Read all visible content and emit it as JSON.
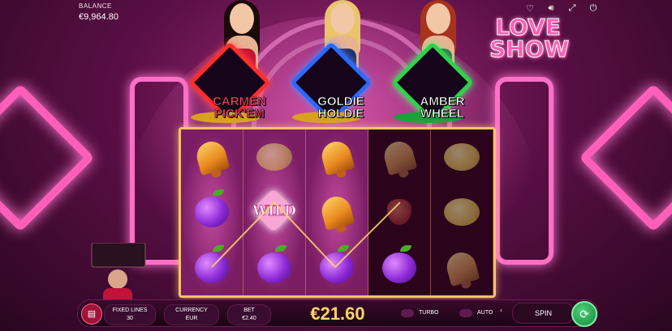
{
  "balance": {
    "label": "BALANCE",
    "value": "€9,964.80"
  },
  "top_icons": [
    "heart-icon",
    "volume-icon",
    "fullscreen-icon",
    "power-icon"
  ],
  "logo": {
    "line1": "LOVE",
    "line2": "SHOW"
  },
  "bonus_features": [
    {
      "name_line1": "CARMEN",
      "name_line2": "PICK'EM",
      "color": "#ff2d2d",
      "text_color": "#ff4a6a"
    },
    {
      "name_line1": "GOLDIE",
      "name_line2": "HOLDIE",
      "color": "#2a6bff",
      "text_color": "#ffffff"
    },
    {
      "name_line1": "AMBER",
      "name_line2": "WHEEL",
      "color": "#2fd24a",
      "text_color": "#ffffff"
    }
  ],
  "reels": [
    [
      "bell",
      "plum",
      "plum"
    ],
    [
      "lemon",
      "wild",
      "plum"
    ],
    [
      "bell",
      "bell",
      "plum"
    ],
    [
      "bell",
      "strawberry",
      "plum"
    ],
    [
      "lemon",
      "lemon",
      "bell"
    ]
  ],
  "wild_label": "WILD",
  "bottom_bar": {
    "fixed_lines_label": "FIXED LINES",
    "fixed_lines_value": "30",
    "currency_label": "CURRENCY",
    "currency_value": "EUR",
    "bet_label": "BET",
    "bet_value": "€2.40",
    "win_amount": "€21.60",
    "turbo_label": "TURBO",
    "auto_label": "AUTO",
    "spin_label": "SPIN"
  },
  "colors": {
    "accent": "#ff5eb4",
    "reel_border": "#f7c26a",
    "win_text": "#ffd46a",
    "spin_green": "#138a3a"
  }
}
